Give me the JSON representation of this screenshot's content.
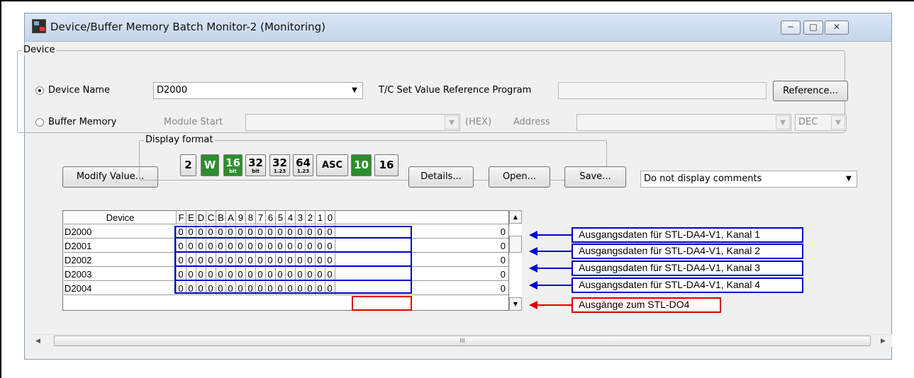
{
  "window": {
    "title": "Device/Buffer Memory Batch Monitor-2 (Monitoring)",
    "controls": {
      "minimize": "─",
      "maximize": "□",
      "close": "✕"
    }
  },
  "device_group": {
    "legend": "Device",
    "device_name_label": "Device Name",
    "device_name_value": "D2000",
    "tc_label": "T/C Set Value Reference Program",
    "tc_value": "",
    "reference_button": "Reference...",
    "buffer_memory_label": "Buffer Memory",
    "module_start_label": "Module Start",
    "hex_label": "(HEX)",
    "address_label": "Address",
    "dec_value": "DEC",
    "selected": "device_name"
  },
  "toolbar": {
    "modify_value_button": "Modify Value...",
    "display_format_legend": "Display format",
    "formats": [
      {
        "id": "2",
        "big": "2",
        "small": ""
      },
      {
        "id": "W",
        "big": "W",
        "small": ""
      },
      {
        "id": "16bit",
        "big": "16",
        "small": "bit"
      },
      {
        "id": "32bit",
        "big": "32",
        "small": "bit"
      },
      {
        "id": "32real",
        "big": "32",
        "small": "1.23"
      },
      {
        "id": "64real",
        "big": "64",
        "small": "1.23"
      },
      {
        "id": "asc",
        "big": "ASC",
        "small": ""
      },
      {
        "id": "10",
        "big": "10",
        "small": ""
      },
      {
        "id": "16",
        "big": "16",
        "small": ""
      }
    ],
    "details_button": "Details...",
    "open_button": "Open...",
    "save_button": "Save...",
    "comment_combo_value": "Do not display comments"
  },
  "grid": {
    "device_header": "Device",
    "bit_headers": [
      "F",
      "E",
      "D",
      "C",
      "B",
      "A",
      "9",
      "8",
      "7",
      "6",
      "5",
      "4",
      "3",
      "2",
      "1",
      "0"
    ],
    "rows": [
      {
        "device": "D2000",
        "bits": [
          "0",
          "0",
          "0",
          "0",
          "0",
          "0",
          "0",
          "0",
          "0",
          "0",
          "0",
          "0",
          "0",
          "0",
          "0",
          "0"
        ],
        "value": "0"
      },
      {
        "device": "D2001",
        "bits": [
          "0",
          "0",
          "0",
          "0",
          "0",
          "0",
          "0",
          "0",
          "0",
          "0",
          "0",
          "0",
          "0",
          "0",
          "0",
          "0"
        ],
        "value": "0"
      },
      {
        "device": "D2002",
        "bits": [
          "0",
          "0",
          "0",
          "0",
          "0",
          "0",
          "0",
          "0",
          "0",
          "0",
          "0",
          "0",
          "0",
          "0",
          "0",
          "0"
        ],
        "value": "0"
      },
      {
        "device": "D2003",
        "bits": [
          "0",
          "0",
          "0",
          "0",
          "0",
          "0",
          "0",
          "0",
          "0",
          "0",
          "0",
          "0",
          "0",
          "0",
          "0",
          "0"
        ],
        "value": "0"
      },
      {
        "device": "D2004",
        "bits": [
          "0",
          "0",
          "0",
          "0",
          "0",
          "0",
          "0",
          "0",
          "0",
          "0",
          "0",
          "0",
          "0",
          "0",
          "0",
          "0"
        ],
        "value": "0"
      }
    ]
  },
  "scrollbar": {
    "thumb_grip": "III"
  },
  "annotations": [
    {
      "text": "Ausgangsdaten für STL-DA4-V1, Kanal 1",
      "color": "#0000cc"
    },
    {
      "text": "Ausgangsdaten für STL-DA4-V1, Kanal 2",
      "color": "#0000cc"
    },
    {
      "text": "Ausgangsdaten für STL-DA4-V1, Kanal 3",
      "color": "#0000cc"
    },
    {
      "text": "Ausgangsdaten für STL-DA4-V1, Kanal 4",
      "color": "#0000cc"
    },
    {
      "text": "Ausgänge zum STL-DO4",
      "color": "#dd0000"
    }
  ]
}
